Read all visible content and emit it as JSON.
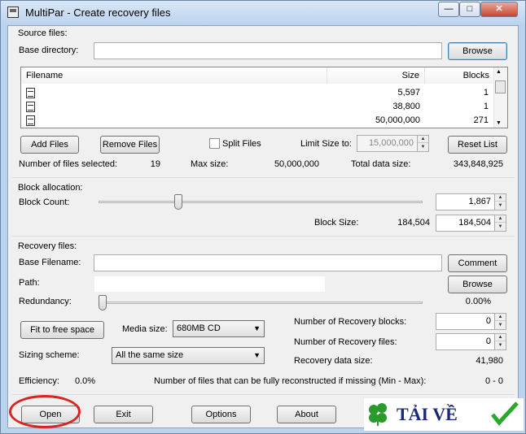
{
  "window": {
    "title": "MultiPar - Create recovery files",
    "minimize_label": "—",
    "maximize_label": "□",
    "close_label": "✕"
  },
  "source": {
    "group_label": "Source files:",
    "base_dir_label": "Base directory:",
    "base_dir_value": "",
    "browse_label": "Browse",
    "columns": [
      "Filename",
      "Size",
      "Blocks"
    ],
    "rows": [
      {
        "name": "",
        "size": "5,597",
        "blocks": "1"
      },
      {
        "name": "",
        "size": "38,800",
        "blocks": "1"
      },
      {
        "name": "",
        "size": "50,000,000",
        "blocks": "271"
      }
    ],
    "add_files_label": "Add Files",
    "remove_files_label": "Remove Files",
    "split_files_label": "Split Files",
    "limit_size_label": "Limit Size to:",
    "limit_size_value": "15,000,000",
    "reset_list_label": "Reset List",
    "num_files_label": "Number of files selected:",
    "num_files_value": "19",
    "max_size_label": "Max size:",
    "max_size_value": "50,000,000",
    "total_size_label": "Total data size:",
    "total_size_value": "343,848,925"
  },
  "block": {
    "group_label": "Block allocation:",
    "count_label": "Block Count:",
    "count_value": "1,867",
    "block_size_label": "Block Size:",
    "block_size_text": "184,504",
    "block_size_value": "184,504",
    "slider_level": 0.24
  },
  "recovery": {
    "group_label": "Recovery files:",
    "base_filename_label": "Base Filename:",
    "base_filename_value": "",
    "comment_label": "Comment",
    "path_label": "Path:",
    "path_value": "",
    "browse_label": "Browse",
    "redundancy_label": "Redundancy:",
    "redundancy_value": "0.00%",
    "redundancy_level": 0.0,
    "fit_label": "Fit to free space",
    "media_size_label": "Media size:",
    "media_size_value": "680MB CD",
    "num_blocks_label": "Number of Recovery blocks:",
    "num_blocks_value": "0",
    "num_files_label": "Number of Recovery files:",
    "num_files_value": "0",
    "sizing_label": "Sizing scheme:",
    "sizing_value": "All the same size",
    "data_size_label": "Recovery data size:",
    "data_size_value": "41,980",
    "efficiency_label": "Efficiency:",
    "efficiency_value": "0.0%",
    "reconstruct_label": "Number of files that can be fully reconstructed if missing (Min - Max):",
    "reconstruct_value": "0 - 0"
  },
  "buttons": {
    "open": "Open",
    "exit": "Exit",
    "options": "Options",
    "about": "About"
  },
  "watermark": {
    "text": "TẢI VỀ"
  },
  "colors": {
    "highlight": "#dd2222",
    "frame": "#bcd3ee"
  }
}
